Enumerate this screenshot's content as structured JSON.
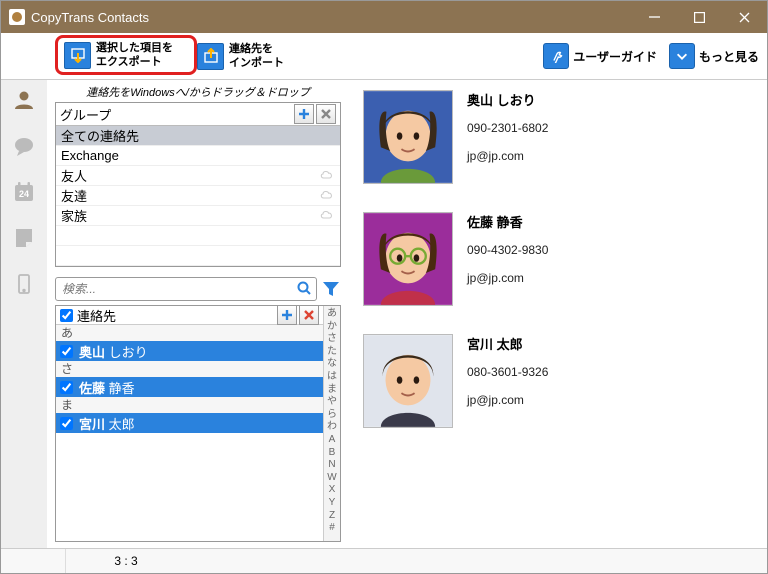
{
  "window": {
    "title": "CopyTrans Contacts"
  },
  "toolbar": {
    "export": {
      "l1": "選択した項目を",
      "l2": "エクスポート"
    },
    "import": {
      "l1": "連絡先を",
      "l2": "インポート"
    },
    "userguide": "ユーザーガイド",
    "more": "もっと見る"
  },
  "hint": "連絡先をWindowsへ/からドラッグ＆ドロップ",
  "groups": {
    "header": "グループ",
    "items": [
      {
        "name": "全ての連絡先",
        "selected": true,
        "cloud": false
      },
      {
        "name": "Exchange",
        "cloud": false
      },
      {
        "name": "友人",
        "cloud": true
      },
      {
        "name": "友達",
        "cloud": true
      },
      {
        "name": "家族",
        "cloud": true
      }
    ]
  },
  "search": {
    "placeholder": "検索..."
  },
  "contacts": {
    "header": "連絡先",
    "index": [
      "あ",
      "か",
      "さ",
      "た",
      "な",
      "は",
      "ま",
      "や",
      "ら",
      "わ",
      "A",
      "B",
      "N",
      "W",
      "X",
      "Y",
      "Z",
      "#"
    ],
    "list": [
      {
        "type": "sep",
        "label": "あ"
      },
      {
        "type": "row",
        "surname": "奥山",
        "given": "しおり"
      },
      {
        "type": "sep",
        "label": "さ"
      },
      {
        "type": "row",
        "surname": "佐藤",
        "given": "静香"
      },
      {
        "type": "sep",
        "label": "ま"
      },
      {
        "type": "row",
        "surname": "宮川",
        "given": "太郎"
      }
    ]
  },
  "details": [
    {
      "name": "奥山 しおり",
      "phone": "090-2301-6802",
      "email": "jp@jp.com",
      "avatar": 0
    },
    {
      "name": "佐藤 静香",
      "phone": "090-4302-9830",
      "email": "jp@jp.com",
      "avatar": 1
    },
    {
      "name": "宮川 太郎",
      "phone": "080-3601-9326",
      "email": "jp@jp.com",
      "avatar": 2
    }
  ],
  "status": {
    "count": "3 : 3"
  }
}
